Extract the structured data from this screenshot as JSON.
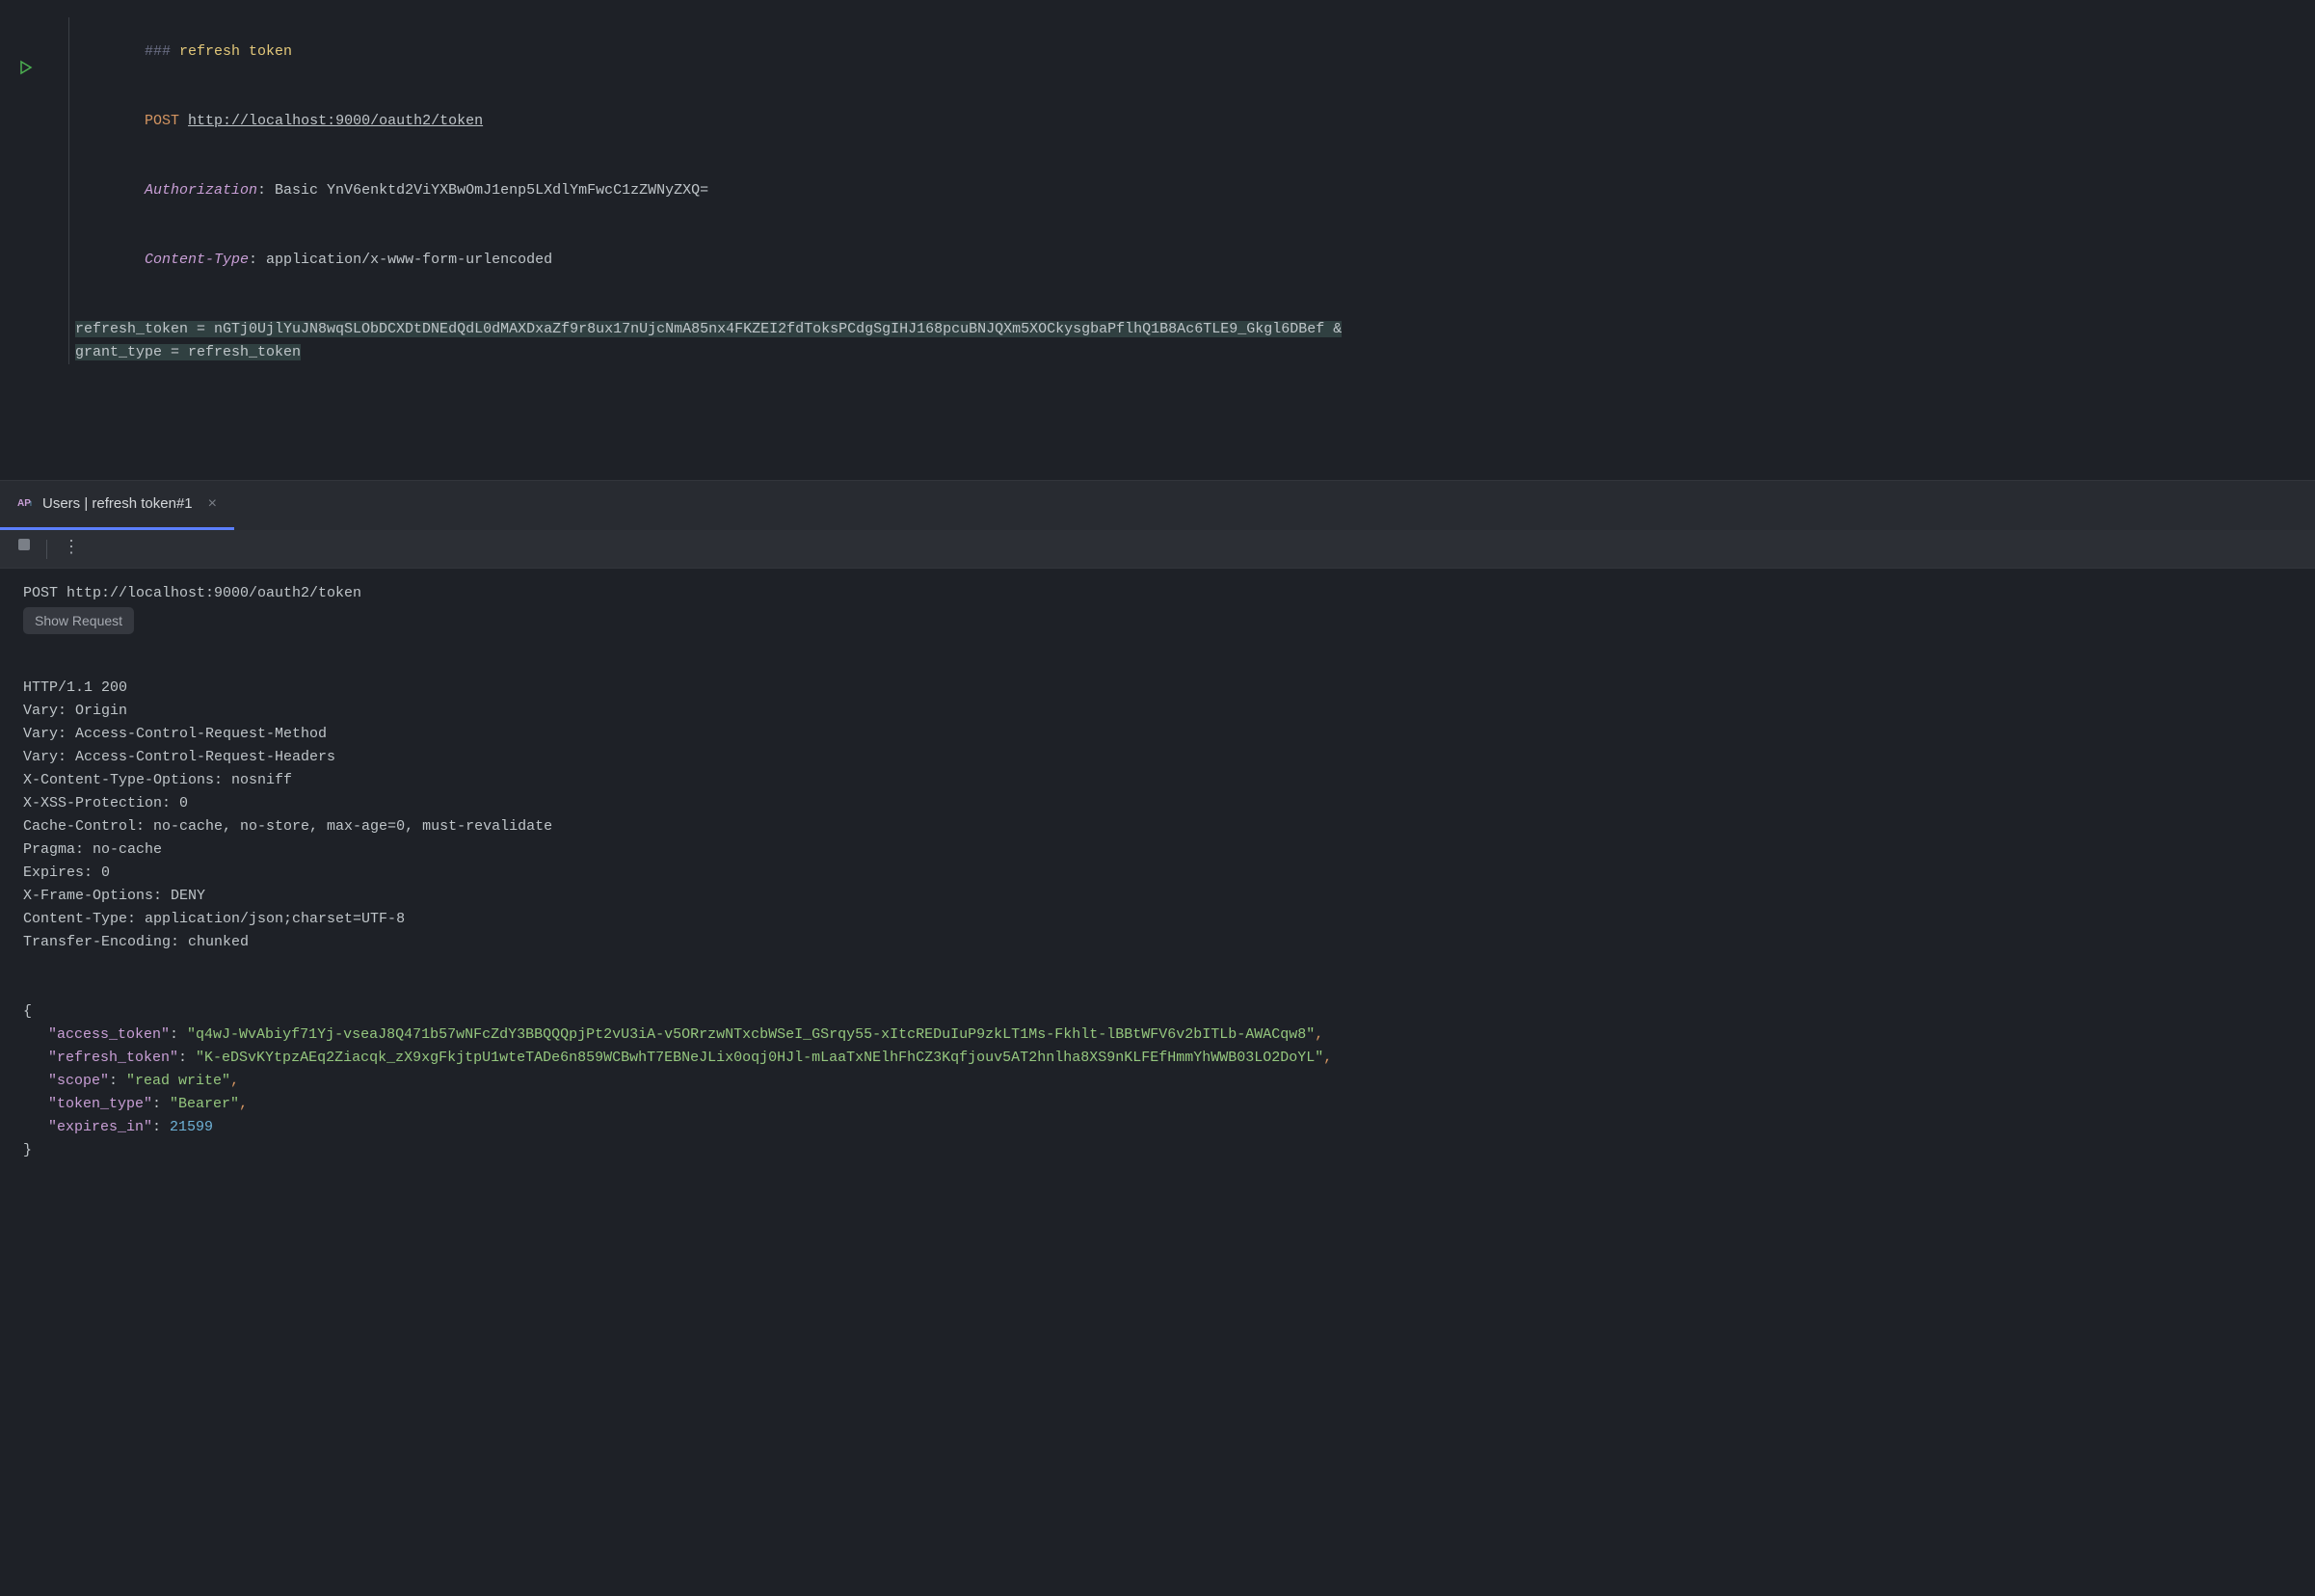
{
  "editor": {
    "comment_prefix": "### ",
    "title": "refresh token",
    "method": "POST",
    "url": "http://localhost:9000/oauth2/token",
    "headers": {
      "authorization_name": "Authorization",
      "authorization_value": ": Basic YnV6enktd2ViYXBwOmJ1enp5LXdlYmFwcC1zZWNyZXQ=",
      "content_type_name": "Content-Type",
      "content_type_value": ": application/x-www-form-urlencoded"
    },
    "body_line1": "refresh_token = nGTj0UjlYuJN8wqSLObDCXDtDNEdQdL0dMAXDxaZf9r8ux17nUjcNmA85nx4FKZEI2fdToksPCdgSgIHJ168pcuBNJQXm5XOCkysgbaPflhQ1B8Ac6TLE9_Gkgl6DBef &",
    "body_line2": "grant_type = refresh_token"
  },
  "tab": {
    "label": "Users | refresh token#1"
  },
  "output": {
    "request_line": "POST http://localhost:9000/oauth2/token",
    "show_request_label": "Show Request",
    "status_line": "HTTP/1.1 200",
    "headers": [
      "Vary: Origin",
      "Vary: Access-Control-Request-Method",
      "Vary: Access-Control-Request-Headers",
      "X-Content-Type-Options: nosniff",
      "X-XSS-Protection: 0",
      "Cache-Control: no-cache, no-store, max-age=0, must-revalidate",
      "Pragma: no-cache",
      "Expires: 0",
      "X-Frame-Options: DENY",
      "Content-Type: application/json;charset=UTF-8",
      "Transfer-Encoding: chunked"
    ],
    "json": {
      "access_token_key": "\"access_token\"",
      "access_token_value": "\"q4wJ-WvAbiyf71Yj-vseaJ8Q471b57wNFcZdY3BBQQQpjPt2vU3iA-v5ORrzwNTxcbWSeI_GSrqy55-xItcREDuIuP9zkLT1Ms-Fkhlt-lBBtWFV6v2bITLb-AWACqw8\"",
      "refresh_token_key": "\"refresh_token\"",
      "refresh_token_value": "\"K-eDSvKYtpzAEq2Ziacqk_zX9xgFkjtpU1wteTADe6n859WCBwhT7EBNeJLix0oqj0HJl-mLaaTxNElhFhCZ3Kqfjouv5AT2hnlha8XS9nKLFEfHmmYhWWB03LO2DoYL\"",
      "scope_key": "\"scope\"",
      "scope_value": "\"read write\"",
      "token_type_key": "\"token_type\"",
      "token_type_value": "\"Bearer\"",
      "expires_in_key": "\"expires_in\"",
      "expires_in_value": "21599"
    }
  }
}
